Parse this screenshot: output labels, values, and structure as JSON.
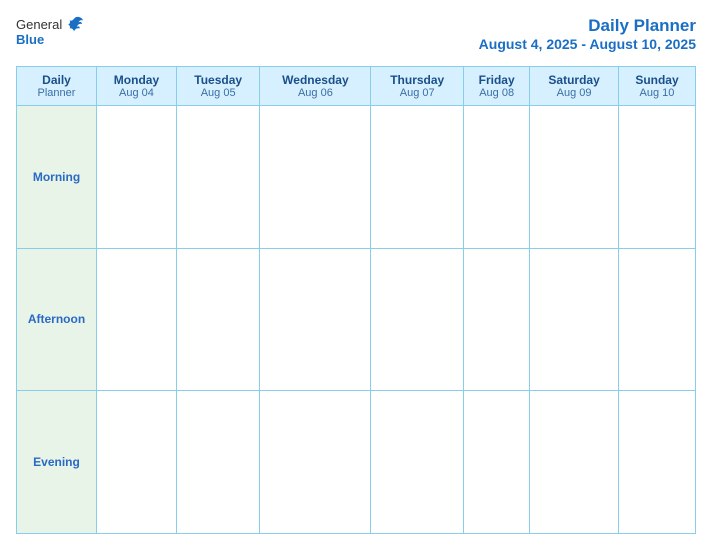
{
  "logo": {
    "general": "General",
    "blue": "Blue"
  },
  "header": {
    "title": "Daily Planner",
    "date_range": "August 4, 2025 - August 10, 2025"
  },
  "table": {
    "header_label_line1": "Daily",
    "header_label_line2": "Planner",
    "columns": [
      {
        "day": "Monday",
        "date": "Aug 04"
      },
      {
        "day": "Tuesday",
        "date": "Aug 05"
      },
      {
        "day": "Wednesday",
        "date": "Aug 06"
      },
      {
        "day": "Thursday",
        "date": "Aug 07"
      },
      {
        "day": "Friday",
        "date": "Aug 08"
      },
      {
        "day": "Saturday",
        "date": "Aug 09"
      },
      {
        "day": "Sunday",
        "date": "Aug 10"
      }
    ],
    "rows": [
      {
        "label": "Morning"
      },
      {
        "label": "Afternoon"
      },
      {
        "label": "Evening"
      }
    ]
  }
}
